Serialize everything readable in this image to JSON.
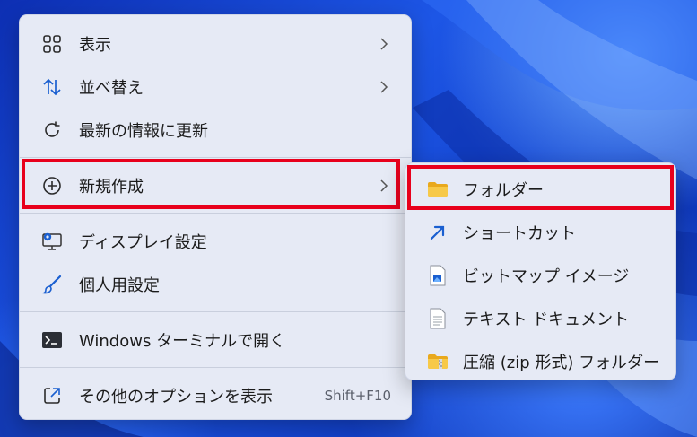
{
  "main_menu": {
    "items": [
      {
        "label": "表示",
        "icon": "grid-view-icon",
        "has_submenu": true
      },
      {
        "label": "並べ替え",
        "icon": "sort-arrows-icon",
        "has_submenu": true
      },
      {
        "label": "最新の情報に更新",
        "icon": "refresh-icon",
        "has_submenu": false
      },
      {
        "label": "新規作成",
        "icon": "plus-circle-icon",
        "has_submenu": true
      },
      {
        "label": "ディスプレイ設定",
        "icon": "display-settings-icon",
        "has_submenu": false
      },
      {
        "label": "個人用設定",
        "icon": "paint-brush-icon",
        "has_submenu": false
      },
      {
        "label": "Windows ターミナルで開く",
        "icon": "terminal-icon",
        "has_submenu": false
      },
      {
        "label": "その他のオプションを表示",
        "icon": "open-external-icon",
        "accelerator": "Shift+F10"
      }
    ]
  },
  "sub_menu": {
    "items": [
      {
        "label": "フォルダー",
        "icon": "folder-icon"
      },
      {
        "label": "ショートカット",
        "icon": "shortcut-arrow-icon"
      },
      {
        "label": "ビットマップ イメージ",
        "icon": "bitmap-image-icon"
      },
      {
        "label": "テキスト ドキュメント",
        "icon": "text-document-icon"
      },
      {
        "label": "圧縮 (zip 形式) フォルダー",
        "icon": "zip-folder-icon"
      }
    ]
  },
  "colors": {
    "highlight_border": "#e8001c",
    "menu_background": "#e6eaf5",
    "icon_accent": "#1a5fd0",
    "folder": "#f4c542"
  }
}
